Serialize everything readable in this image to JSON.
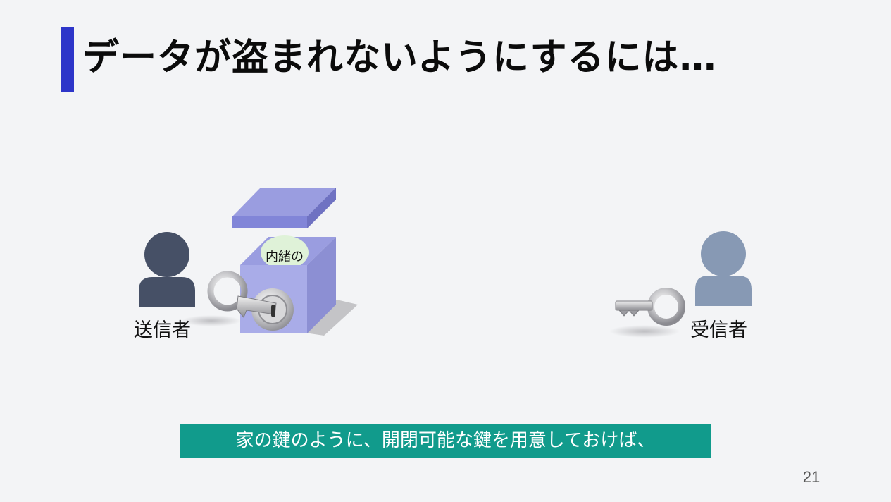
{
  "slide": {
    "title": "データが盗まれないようにするには…",
    "sender_label": "送信者",
    "receiver_label": "受信者",
    "box_content_label": "内緒の",
    "caption": "家の鍵のように、開閉可能な鍵を用意しておけば、",
    "page_number": "21"
  },
  "icons": {
    "sender": "person-icon",
    "receiver": "person-icon",
    "box": "lockbox-icon",
    "sender_key": "key-icon",
    "receiver_key": "key-icon"
  },
  "colors": {
    "accent_bar": "#2d35c9",
    "caption_bg": "#119b8c",
    "sender_person": "#465066",
    "receiver_person": "#8799b4",
    "box": "#9a9de0"
  }
}
